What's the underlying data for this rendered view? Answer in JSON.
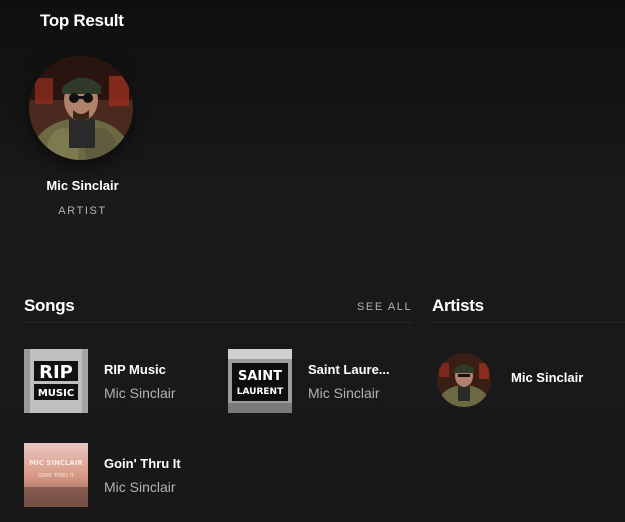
{
  "top_result": {
    "heading": "Top Result",
    "name": "Mic Sinclair",
    "type": "ARTIST",
    "avatar_icon": "artist-portrait-image"
  },
  "songs": {
    "heading": "Songs",
    "see_all": "SEE ALL",
    "items": [
      {
        "title": "RIP Music",
        "artist": "Mic Sinclair",
        "cover_top": "RIP",
        "cover_bottom": "MUSIC"
      },
      {
        "title": "Saint Laure...",
        "artist": "Mic Sinclair",
        "cover_top": "SAINT",
        "cover_bottom": "LAURENT"
      },
      {
        "title": "Goin' Thru It",
        "artist": "Mic Sinclair",
        "cover_top": "MIC SINCLAIR",
        "cover_bottom": "GOIN' THRU IT"
      }
    ]
  },
  "artists": {
    "heading": "Artists",
    "items": [
      {
        "name": "Mic Sinclair"
      }
    ]
  },
  "colors": {
    "background": "#181818",
    "text_primary": "#ffffff",
    "text_secondary": "#b3b3b3",
    "divider": "#282828"
  }
}
